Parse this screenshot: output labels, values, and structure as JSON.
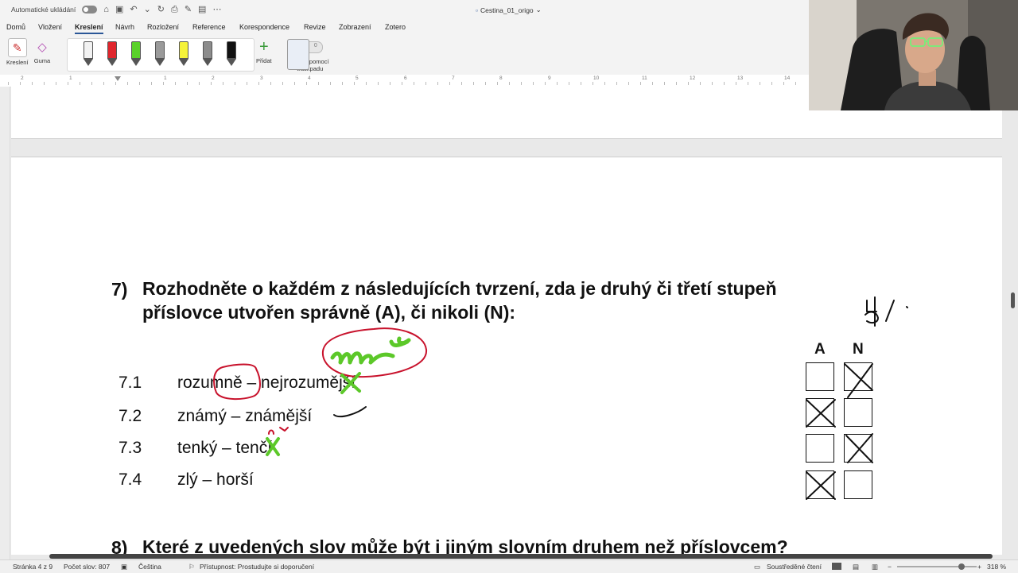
{
  "titlebar": {
    "autosave_label": "Automatické ukládání",
    "doc_title": "Cestina_01_origo",
    "doc_title_suffix": "⌄"
  },
  "menu": {
    "tabs": [
      "Domů",
      "Vložení",
      "Kreslení",
      "Návrh",
      "Rozložení",
      "Reference",
      "Korespondence",
      "Revize",
      "Zobrazení",
      "Zotero"
    ],
    "active": "Kreslení"
  },
  "ribbon": {
    "draw_label": "Kreslení",
    "eraser_label": "Guma",
    "add_label": "Přidat",
    "trackpad_label_1": "Kreslit pomocí",
    "trackpad_label_2": "trackpadu",
    "toggle_value": "0",
    "pens": [
      {
        "color": "#f2f2f2"
      },
      {
        "color": "#e0262d"
      },
      {
        "color": "#5ad12a"
      },
      {
        "color": "#9a9a9a"
      },
      {
        "color": "#f5f23a"
      },
      {
        "color": "#8c8c8c"
      },
      {
        "color": "#111111"
      }
    ]
  },
  "ruler": {
    "numbers": [
      "2",
      "1",
      "1",
      "2",
      "3",
      "4",
      "5",
      "6",
      "7",
      "8",
      "9",
      "10",
      "11",
      "12",
      "13",
      "14"
    ]
  },
  "question7": {
    "number": "7)",
    "line1": "Rozhodněte o každém z následujících tvrzení, zda je druhý či třetí stupeň",
    "line2": "příslovce utvořen správně (A), či nikoli (N):",
    "col_a": "A",
    "col_n": "N",
    "items": [
      {
        "num": "7.1",
        "text": "rozumně – nejrozumější",
        "answer": "N"
      },
      {
        "num": "7.2",
        "text": "známý – známější",
        "answer": "A"
      },
      {
        "num": "7.3",
        "text": "tenký – tenčí",
        "answer": "N"
      },
      {
        "num": "7.4",
        "text": "zlý – horší",
        "answer": "A"
      }
    ]
  },
  "question8": {
    "number": "8)",
    "text": "Které z uvedených slov může být i jiným slovním druhem než příslovcem?"
  },
  "status": {
    "page": "Stránka 4 z 9",
    "words": "Počet slov: 807",
    "language": "Čeština",
    "accessibility": "Přístupnost: Prostudujte si doporučení",
    "focus": "Soustředěné čtení",
    "zoom": "318 %"
  },
  "colors": {
    "ink_green": "#5cc829",
    "ink_red": "#c8122c",
    "ink_black": "#111111"
  }
}
